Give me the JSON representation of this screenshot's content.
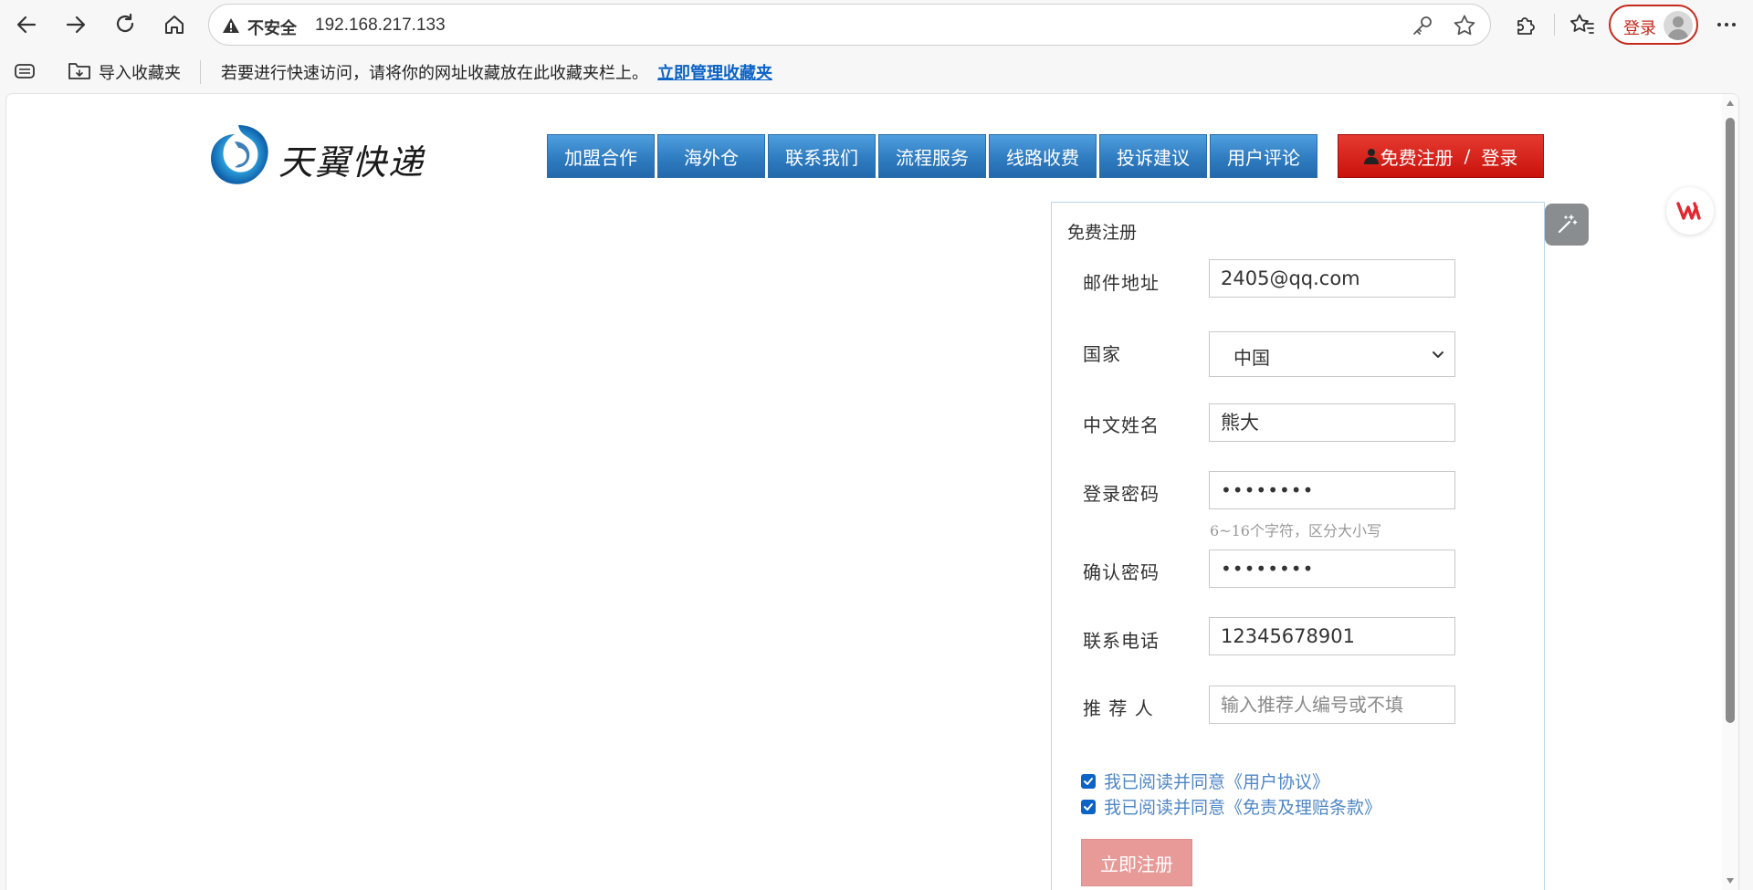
{
  "browser": {
    "security_label": "不安全",
    "url": "192.168.217.133",
    "login_label": "登录",
    "favorites_bar": {
      "import_label": "导入收藏夹",
      "hint_text": "若要进行快速访问，请将你的网址收藏放在此收藏夹栏上。",
      "manage_link": "立即管理收藏夹"
    },
    "icons": [
      "back-arrow-icon",
      "forward-arrow-icon",
      "refresh-icon",
      "home-icon",
      "warning-icon",
      "key-icon",
      "star-icon",
      "extensions-icon",
      "favorites-icon",
      "avatar-icon",
      "more-icon",
      "tabs-icon",
      "folder-import-icon"
    ]
  },
  "site": {
    "logo_text": "天翼快递",
    "nav": [
      "加盟合作",
      "海外仓",
      "联系我们",
      "流程服务",
      "线路收费",
      "投诉建议",
      "用户评论"
    ],
    "register_button": {
      "register": "免费注册",
      "separator": "/",
      "login": "登录"
    }
  },
  "form": {
    "title": "免费注册",
    "fields": {
      "email": {
        "label": "邮件地址",
        "value": "2405@qq.com"
      },
      "country": {
        "label": "国家",
        "value": "中国"
      },
      "chinese_name": {
        "label": "中文姓名",
        "value": "熊大"
      },
      "password": {
        "label": "登录密码",
        "value": "••••••••",
        "hint": "6~16个字符，区分大小写"
      },
      "confirm_password": {
        "label": "确认密码",
        "value": "••••••••"
      },
      "phone": {
        "label": "联系电话",
        "value": "12345678901"
      },
      "referrer": {
        "label": "推 荐 人",
        "placeholder": "输入推荐人编号或不填"
      }
    },
    "agreements": [
      {
        "label": "我已阅读并同意《用户协议》",
        "checked": true
      },
      {
        "label": "我已阅读并同意《免责及理赔条款》",
        "checked": true
      }
    ],
    "submit_label": "立即注册"
  },
  "colors": {
    "nav_blue": "#2f7cc1",
    "register_red": "#c9120b",
    "submit_pink": "#e79a98",
    "link_blue": "#0b63c7",
    "agreement_text": "#4f86c6"
  }
}
